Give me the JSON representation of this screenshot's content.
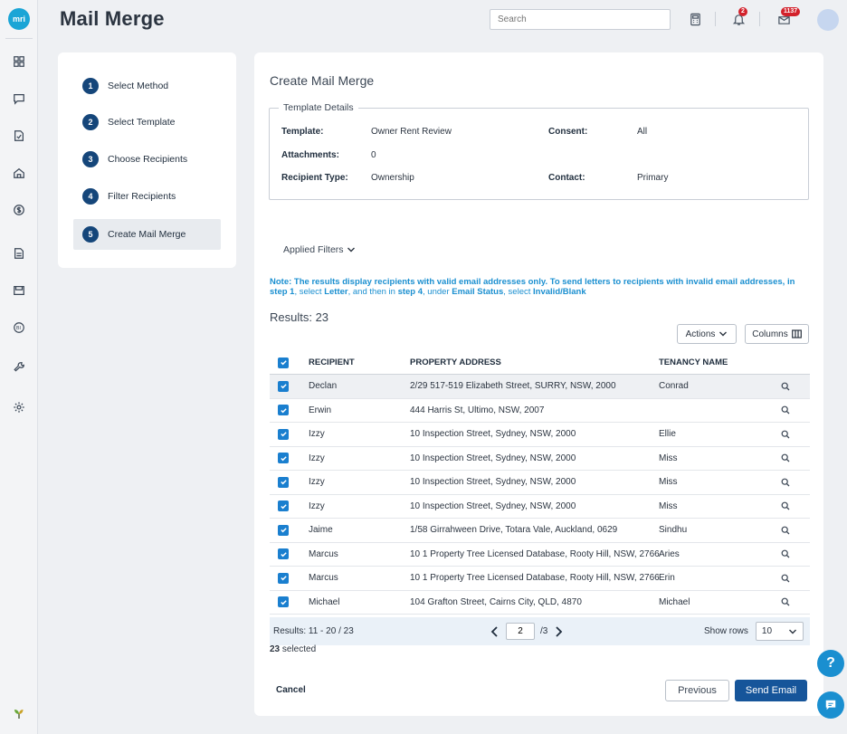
{
  "app": {
    "logo_text": "mri",
    "page_title": "Mail Merge"
  },
  "header": {
    "search_placeholder": "Search",
    "notifications_count": "2",
    "messages_count": "1137"
  },
  "rail": {
    "icons": [
      "dashboard-icon",
      "chat-icon",
      "document-check-icon",
      "home-icon",
      "dollar-icon",
      "ledger-icon",
      "inbox-icon",
      "bi-icon",
      "wrench-icon",
      "settings-icon"
    ]
  },
  "steps": [
    {
      "num": "1",
      "label": "Select Method"
    },
    {
      "num": "2",
      "label": "Select Template"
    },
    {
      "num": "3",
      "label": "Choose Recipients"
    },
    {
      "num": "4",
      "label": "Filter Recipients"
    },
    {
      "num": "5",
      "label": "Create Mail Merge"
    }
  ],
  "main": {
    "title": "Create Mail Merge",
    "template_details": {
      "legend": "Template Details",
      "template_label": "Template:",
      "template_value": "Owner Rent Review",
      "consent_label": "Consent:",
      "consent_value": "All",
      "attachments_label": "Attachments:",
      "attachments_value": "0",
      "recipient_type_label": "Recipient Type:",
      "recipient_type_value": "Ownership",
      "contact_label": "Contact:",
      "contact_value": "Primary"
    },
    "applied_filters": "Applied Filters",
    "note": {
      "p1": "Note: The results display recipients with valid email addresses only. To send letters to recipients with invalid email addresses, in ",
      "p2": "step 1",
      "p3": ", select ",
      "p4": "Letter",
      "p5": ", and then in ",
      "p6": "step 4",
      "p7": ", under ",
      "p8": "Email Status",
      "p9": ", select ",
      "p10": "Invalid/Blank"
    },
    "results_label": "Results: 23",
    "actions_label": "Actions",
    "columns_label": "Columns"
  },
  "table": {
    "headers": [
      "RECIPIENT",
      "PROPERTY ADDRESS",
      "TENANCY NAME"
    ],
    "rows": [
      {
        "recipient": "Declan",
        "address": "2/29 517-519 Elizabeth Street, SURRY, NSW, 2000",
        "tenancy": "Conrad"
      },
      {
        "recipient": "Erwin",
        "address": "444 Harris St, Ultimo, NSW, 2007",
        "tenancy": ""
      },
      {
        "recipient": "Izzy",
        "address": "10 Inspection Street, Sydney, NSW, 2000",
        "tenancy": "Ellie"
      },
      {
        "recipient": "Izzy",
        "address": "10 Inspection Street, Sydney, NSW, 2000",
        "tenancy": "Miss"
      },
      {
        "recipient": "Izzy",
        "address": "10 Inspection Street, Sydney, NSW, 2000",
        "tenancy": "Miss"
      },
      {
        "recipient": "Izzy",
        "address": "10 Inspection Street, Sydney, NSW, 2000",
        "tenancy": "Miss"
      },
      {
        "recipient": "Jaime",
        "address": "1/58 Girrahween Drive, Totara Vale, Auckland, 0629",
        "tenancy": "Sindhu"
      },
      {
        "recipient": "Marcus",
        "address": "10 1 Property Tree Licensed Database, Rooty Hill, NSW, 2766",
        "tenancy": "Aries"
      },
      {
        "recipient": "Marcus",
        "address": "10 1 Property Tree Licensed Database, Rooty Hill, NSW, 2766",
        "tenancy": "Erin"
      },
      {
        "recipient": "Michael",
        "address": "104 Grafton Street, Cairns City, QLD, 4870",
        "tenancy": "Michael"
      }
    ]
  },
  "pager": {
    "results_range": "Results: 11 - 20 / 23",
    "current_page": "2",
    "total_pages": "/3",
    "show_rows_label": "Show rows",
    "rows_per_page": "10"
  },
  "selection": {
    "count": "23",
    "suffix": " selected"
  },
  "footer": {
    "cancel": "Cancel",
    "previous": "Previous",
    "send_email": "Send Email"
  },
  "fab": {
    "help": "?"
  },
  "colors": {
    "primary": "#16559a",
    "accent": "#1a8fd0",
    "step_circle": "#15467a",
    "badge": "#d3212b"
  }
}
